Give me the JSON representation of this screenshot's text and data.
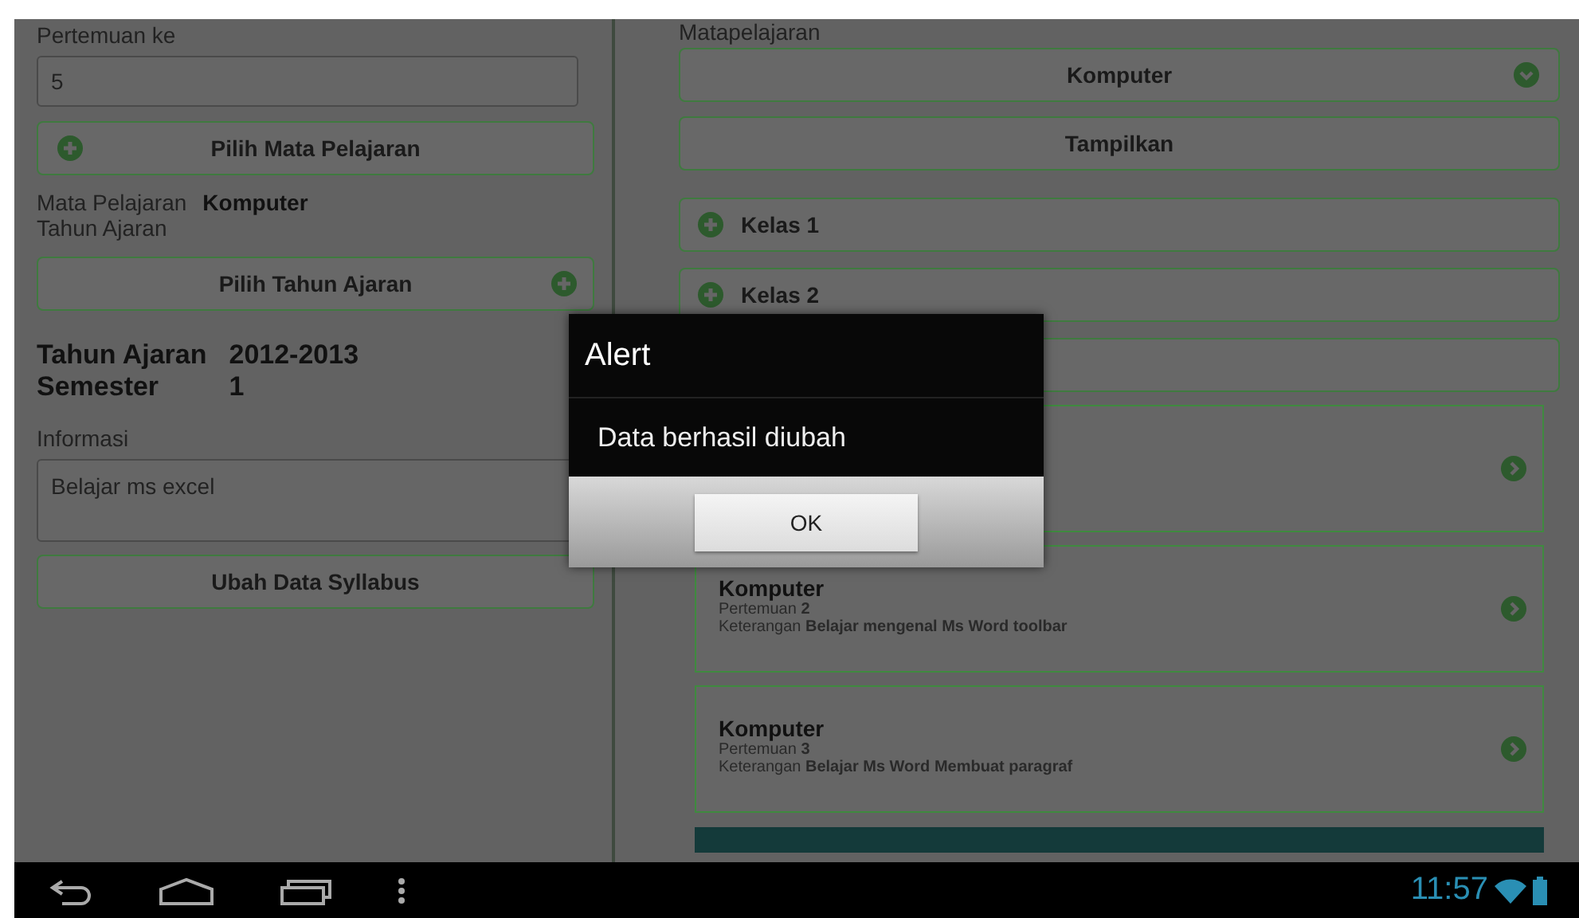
{
  "form": {
    "meeting_label": "Pertemuan ke",
    "meeting_value": "5",
    "pick_subject_button": "Pilih Mata Pelajaran",
    "subject_label": "Mata Pelajaran",
    "subject_value": "Komputer",
    "year_label": "Tahun Ajaran",
    "pick_year_button": "Pilih Tahun Ajaran",
    "summary": [
      {
        "label": "Tahun Ajaran",
        "value": "2012-2013"
      },
      {
        "label": "Semester",
        "value": "1"
      }
    ],
    "info_label": "Informasi",
    "info_value": "Belajar ms excel",
    "submit_button": "Ubah Data Syllabus"
  },
  "browser": {
    "subject_label": "Matapelajaran",
    "subject_dropdown": "Komputer",
    "show_button": "Tampilkan",
    "classes": [
      {
        "label": "Kelas 1"
      },
      {
        "label": "Kelas 2"
      }
    ],
    "syllabus": [
      {
        "title": "Komputer",
        "meeting_label": "Pertemuan",
        "meeting": "2",
        "note_label": "Keterangan",
        "note": "Belajar mengenal Ms Word toolbar"
      },
      {
        "title": "Komputer",
        "meeting_label": "Pertemuan",
        "meeting": "3",
        "note_label": "Keterangan",
        "note": "Belajar Ms Word Membuat paragraf"
      }
    ]
  },
  "dialog": {
    "title": "Alert",
    "message": "Data berhasil diubah",
    "button": "OK"
  },
  "status_bar": {
    "time": "11:57"
  }
}
